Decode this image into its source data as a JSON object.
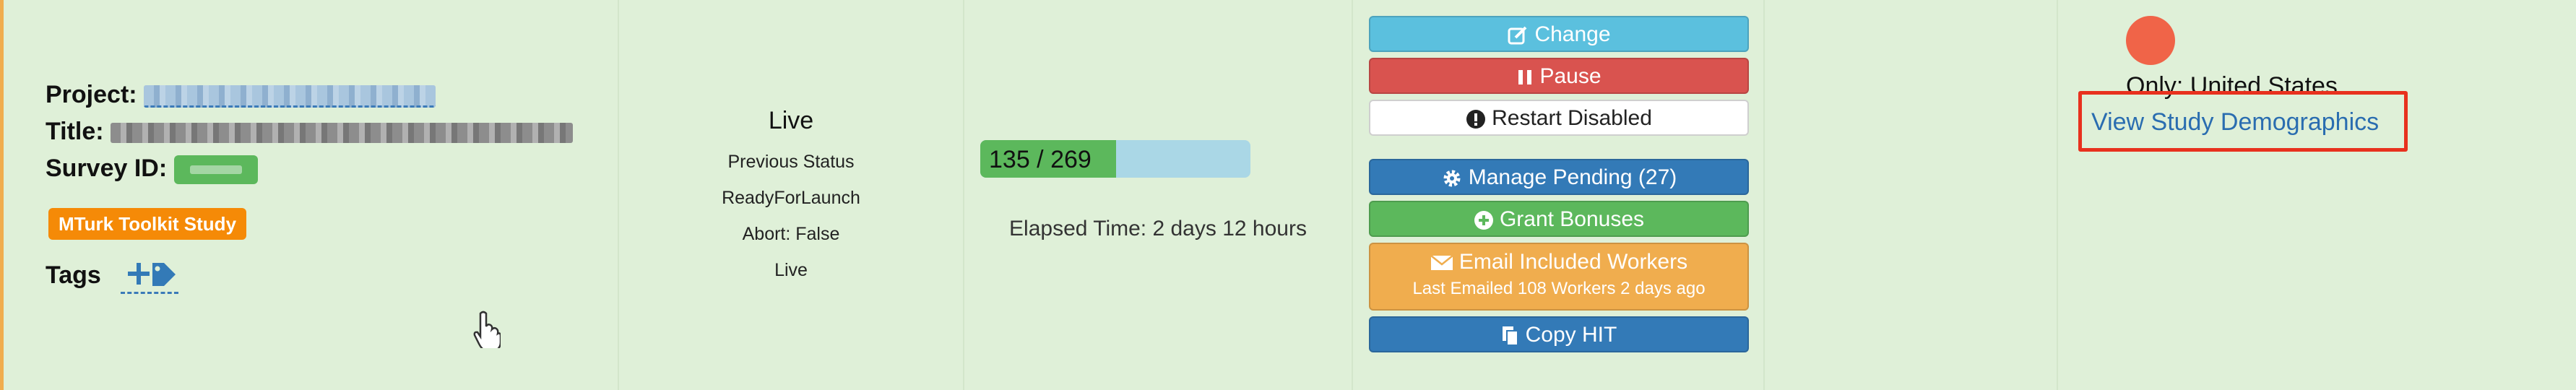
{
  "project": {
    "label": "Project:"
  },
  "title": {
    "label": "Title:"
  },
  "survey": {
    "label": "Survey ID:"
  },
  "badge": {
    "text": "MTurk Toolkit Study"
  },
  "tags": {
    "label": "Tags"
  },
  "status": {
    "current": "Live",
    "previous_label": "Previous Status",
    "previous_value": "ReadyForLaunch",
    "abort": "Abort: False",
    "live": "Live"
  },
  "progress": {
    "text": "135 / 269",
    "completed": 135,
    "total": 269
  },
  "elapsed": {
    "text": "Elapsed Time: 2 days 12 hours"
  },
  "actions": {
    "change": "Change",
    "pause": "Pause",
    "restart": "Restart Disabled",
    "manage_pending": "Manage Pending (27)",
    "grant_bonuses": "Grant Bonuses",
    "email_workers": "Email Included Workers",
    "email_sub": "Last Emailed 108 Workers 2 days ago",
    "copy_hit": "Copy HIT"
  },
  "demographics": {
    "only": "Only: United States",
    "link": "View Study Demographics"
  },
  "colors": {
    "row_bg": "#dff0d8",
    "accent_border": "#f0ad4e",
    "badge_orange": "#f58a07",
    "status_dot": "#f06448",
    "highlight_box": "#e8311e"
  }
}
